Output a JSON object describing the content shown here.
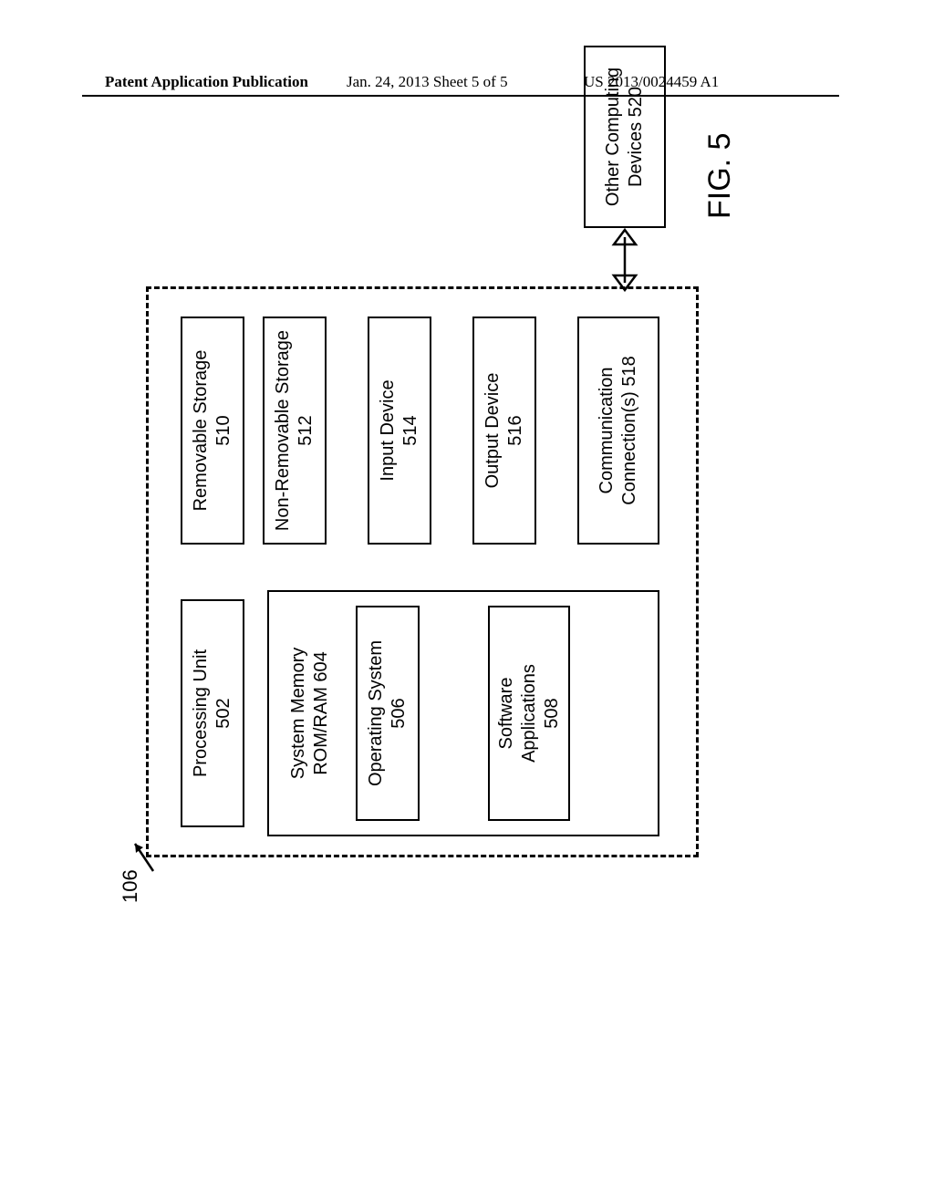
{
  "header": {
    "left": "Patent Application Publication",
    "mid": "Jan. 24, 2013  Sheet 5 of 5",
    "right": "US 2013/0024459 A1"
  },
  "figure": {
    "ref": "106",
    "caption": "FIG. 5",
    "left_col": {
      "proc": {
        "title": "Processing Unit",
        "num": "502"
      },
      "mem_hdr": {
        "title": "System Memory\nROM/RAM 604"
      },
      "os": {
        "title": "Operating System",
        "num": "506"
      },
      "apps": {
        "title": "Software\nApplications",
        "num": "508"
      }
    },
    "right_col": {
      "rem": {
        "title": "Removable Storage",
        "num": "510"
      },
      "nrem": {
        "title": "Non-Removable Storage",
        "num": "512"
      },
      "inp": {
        "title": "Input Device",
        "num": "514"
      },
      "out": {
        "title": "Output Device",
        "num": "516"
      },
      "comm": {
        "title": "Communication\nConnection(s) 518"
      }
    },
    "ext": {
      "other": {
        "title": "Other Computing\nDevices 520"
      }
    }
  }
}
